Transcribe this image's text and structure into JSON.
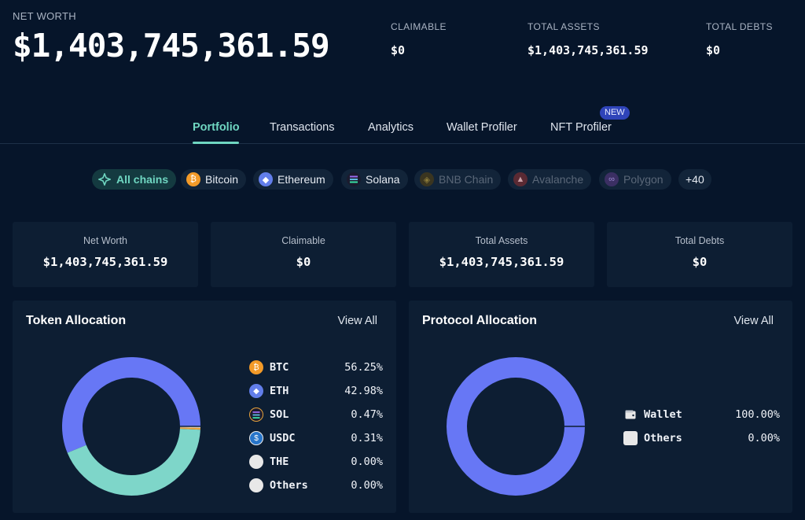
{
  "header": {
    "net_worth_label": "NET WORTH",
    "net_worth_value": "$1,403,745,361.59",
    "stats": [
      {
        "label": "CLAIMABLE",
        "value": "$0"
      },
      {
        "label": "TOTAL ASSETS",
        "value": "$1,403,745,361.59"
      },
      {
        "label": "TOTAL DEBTS",
        "value": "$0"
      }
    ]
  },
  "tabs": [
    {
      "label": "Portfolio",
      "active": true
    },
    {
      "label": "Transactions"
    },
    {
      "label": "Analytics"
    },
    {
      "label": "Wallet Profiler"
    },
    {
      "label": "NFT Profiler"
    }
  ],
  "new_badge": "NEW",
  "chains": [
    {
      "label": "All chains",
      "icon": "all-chains-icon",
      "color": "#6fd6c1"
    },
    {
      "label": "Bitcoin",
      "icon": "bitcoin-icon",
      "color": "#f39a28"
    },
    {
      "label": "Ethereum",
      "icon": "ethereum-icon",
      "color": "#627eea"
    },
    {
      "label": "Solana",
      "icon": "solana-icon",
      "color": "#1b1b2e"
    },
    {
      "label": "BNB Chain",
      "icon": "bnb-icon",
      "color": "#3a3520"
    },
    {
      "label": "Avalanche",
      "icon": "avalanche-icon",
      "color": "#5a2a33"
    },
    {
      "label": "Polygon",
      "icon": "polygon-icon",
      "color": "#3b2f63"
    },
    {
      "label": "+40"
    }
  ],
  "cards": [
    {
      "label": "Net Worth",
      "value": "$1,403,745,361.59"
    },
    {
      "label": "Claimable",
      "value": "$0"
    },
    {
      "label": "Total Assets",
      "value": "$1,403,745,361.59"
    },
    {
      "label": "Total Debts",
      "value": "$0"
    }
  ],
  "token_panel": {
    "title": "Token Allocation",
    "view_all": "View All"
  },
  "protocol_panel": {
    "title": "Protocol Allocation",
    "view_all": "View All"
  },
  "colors": {
    "background": "#06152a",
    "panel": "#0d1e33",
    "accent": "#6fd6c1",
    "donut_primary": "#6777f5",
    "donut_secondary": "#7ed6c9"
  },
  "chart_data": [
    {
      "type": "pie",
      "variant": "donut",
      "categories": [
        "BTC",
        "ETH",
        "SOL",
        "USDC",
        "THE",
        "Others"
      ],
      "values": [
        56.25,
        42.98,
        0.47,
        0.31,
        0.0,
        0.0
      ],
      "labels": [
        "56.25%",
        "42.98%",
        "0.47%",
        "0.31%",
        "0.00%",
        "0.00%"
      ],
      "colors": [
        "#6777f5",
        "#7ed6c9",
        "#e6a23c",
        "#f0f0f0",
        "#e8e8e8",
        "#e8e8e8"
      ]
    },
    {
      "type": "pie",
      "variant": "donut",
      "categories": [
        "Wallet",
        "Others"
      ],
      "values": [
        100.0,
        0.0
      ],
      "labels": [
        "100.00%",
        "0.00%"
      ],
      "colors": [
        "#6777f5",
        "#e8e8e8"
      ]
    }
  ]
}
